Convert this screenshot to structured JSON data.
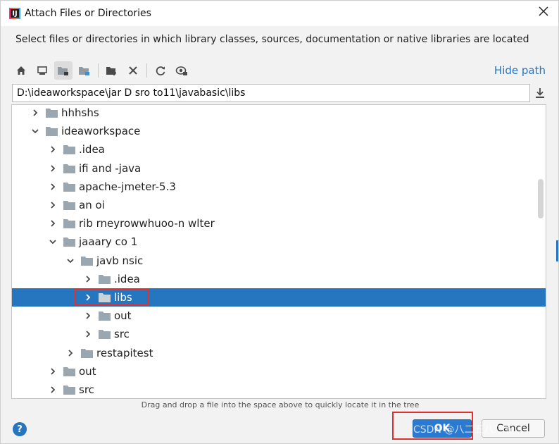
{
  "window": {
    "title": "Attach Files or Directories",
    "app_icon_label": "IJ"
  },
  "description": "Select files or directories in which library classes, sources, documentation or native libraries are located",
  "toolbar": {
    "icons": [
      "home-icon",
      "desktop-icon",
      "project-icon",
      "module-icon",
      "new-folder-icon",
      "delete-icon",
      "refresh-icon",
      "show-hidden-icon"
    ],
    "hide_path_label": "Hide path"
  },
  "path": {
    "value": "D:\\ideaworkspace\\jar D sro to11\\javabasic\\libs"
  },
  "tree": {
    "rows": [
      {
        "label": "hhhshs",
        "depth": 1,
        "expanded": false,
        "selected": false
      },
      {
        "label": "ideaworkspace",
        "depth": 1,
        "expanded": true,
        "selected": false
      },
      {
        "label": ".idea",
        "depth": 2,
        "expanded": false,
        "selected": false
      },
      {
        "label": "ifi and -java",
        "depth": 2,
        "expanded": false,
        "selected": false
      },
      {
        "label": "apache-jmeter-5.3",
        "depth": 2,
        "expanded": false,
        "selected": false
      },
      {
        "label": "an oi",
        "depth": 2,
        "expanded": false,
        "selected": false
      },
      {
        "label": "rib rneyrowwhuoo-n wlter",
        "depth": 2,
        "expanded": false,
        "selected": false
      },
      {
        "label": "jaaary co 1",
        "depth": 2,
        "expanded": true,
        "selected": false
      },
      {
        "label": "javb nsic",
        "depth": 3,
        "expanded": true,
        "selected": false
      },
      {
        "label": ".idea",
        "depth": 4,
        "expanded": false,
        "selected": false
      },
      {
        "label": "libs",
        "depth": 4,
        "expanded": false,
        "selected": true
      },
      {
        "label": "out",
        "depth": 4,
        "expanded": false,
        "selected": false
      },
      {
        "label": "src",
        "depth": 4,
        "expanded": false,
        "selected": false
      },
      {
        "label": "restapitest",
        "depth": 3,
        "expanded": false,
        "selected": false
      },
      {
        "label": "out",
        "depth": 2,
        "expanded": false,
        "selected": false
      },
      {
        "label": "src",
        "depth": 2,
        "expanded": false,
        "selected": false
      }
    ]
  },
  "hint": "Drag and drop a file into the space above to quickly locate it in the tree",
  "buttons": {
    "help_label": "?",
    "ok_label": "OK",
    "cancel_label": "Cancel"
  },
  "watermark": "CSDN @八二五八二五",
  "colors": {
    "accent": "#2675bf",
    "selection": "#2675bf",
    "annotation_red": "#e0312f",
    "folder": "#9aa7b0"
  }
}
